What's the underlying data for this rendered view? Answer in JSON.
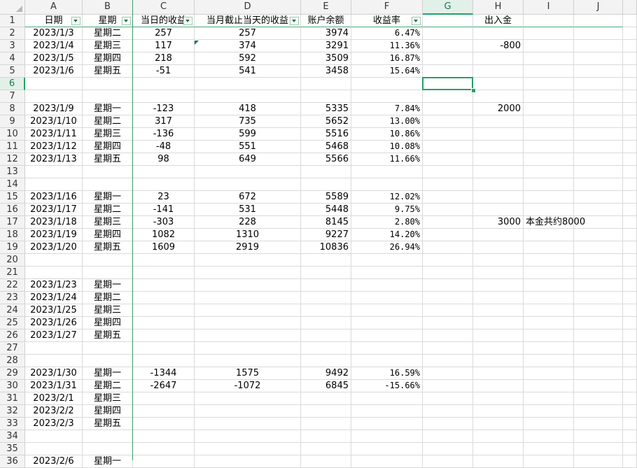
{
  "columns": [
    "A",
    "B",
    "C",
    "D",
    "E",
    "F",
    "G",
    "H",
    "I",
    "J"
  ],
  "selected_cell": "G6",
  "header": {
    "A": "日期",
    "B": "星期",
    "C": "当日的收益",
    "D": "当月截止当天的收益",
    "E": "账户余额",
    "F": "收益率",
    "G": "",
    "H": "出入金",
    "I": "",
    "J": ""
  },
  "rows": [
    {
      "n": "2",
      "A": "2023/1/3",
      "B": "星期二",
      "C": "257",
      "D": "257",
      "E": "3974",
      "F": "6.47%",
      "H": "",
      "I": ""
    },
    {
      "n": "3",
      "A": "2023/1/4",
      "B": "星期三",
      "C": "117",
      "D": "374",
      "E": "3291",
      "F": "11.36%",
      "H": "-800",
      "I": ""
    },
    {
      "n": "4",
      "A": "2023/1/5",
      "B": "星期四",
      "C": "218",
      "D": "592",
      "E": "3509",
      "F": "16.87%",
      "H": "",
      "I": ""
    },
    {
      "n": "5",
      "A": "2023/1/6",
      "B": "星期五",
      "C": "-51",
      "D": "541",
      "E": "3458",
      "F": "15.64%",
      "H": "",
      "I": ""
    },
    {
      "n": "6",
      "A": "",
      "B": "",
      "C": "",
      "D": "",
      "E": "",
      "F": "",
      "H": "",
      "I": ""
    },
    {
      "n": "7",
      "A": "",
      "B": "",
      "C": "",
      "D": "",
      "E": "",
      "F": "",
      "H": "",
      "I": ""
    },
    {
      "n": "8",
      "A": "2023/1/9",
      "B": "星期一",
      "C": "-123",
      "D": "418",
      "E": "5335",
      "F": "7.84%",
      "H": "2000",
      "I": ""
    },
    {
      "n": "9",
      "A": "2023/1/10",
      "B": "星期二",
      "C": "317",
      "D": "735",
      "E": "5652",
      "F": "13.00%",
      "H": "",
      "I": ""
    },
    {
      "n": "10",
      "A": "2023/1/11",
      "B": "星期三",
      "C": "-136",
      "D": "599",
      "E": "5516",
      "F": "10.86%",
      "H": "",
      "I": ""
    },
    {
      "n": "11",
      "A": "2023/1/12",
      "B": "星期四",
      "C": "-48",
      "D": "551",
      "E": "5468",
      "F": "10.08%",
      "H": "",
      "I": ""
    },
    {
      "n": "12",
      "A": "2023/1/13",
      "B": "星期五",
      "C": "98",
      "D": "649",
      "E": "5566",
      "F": "11.66%",
      "H": "",
      "I": ""
    },
    {
      "n": "13",
      "A": "",
      "B": "",
      "C": "",
      "D": "",
      "E": "",
      "F": "",
      "H": "",
      "I": ""
    },
    {
      "n": "14",
      "A": "",
      "B": "",
      "C": "",
      "D": "",
      "E": "",
      "F": "",
      "H": "",
      "I": ""
    },
    {
      "n": "15",
      "A": "2023/1/16",
      "B": "星期一",
      "C": "23",
      "D": "672",
      "E": "5589",
      "F": "12.02%",
      "H": "",
      "I": ""
    },
    {
      "n": "16",
      "A": "2023/1/17",
      "B": "星期二",
      "C": "-141",
      "D": "531",
      "E": "5448",
      "F": "9.75%",
      "H": "",
      "I": ""
    },
    {
      "n": "17",
      "A": "2023/1/18",
      "B": "星期三",
      "C": "-303",
      "D": "228",
      "E": "8145",
      "F": "2.80%",
      "H": "3000",
      "I": "本金共约8000"
    },
    {
      "n": "18",
      "A": "2023/1/19",
      "B": "星期四",
      "C": "1082",
      "D": "1310",
      "E": "9227",
      "F": "14.20%",
      "H": "",
      "I": ""
    },
    {
      "n": "19",
      "A": "2023/1/20",
      "B": "星期五",
      "C": "1609",
      "D": "2919",
      "E": "10836",
      "F": "26.94%",
      "H": "",
      "I": ""
    },
    {
      "n": "20",
      "A": "",
      "B": "",
      "C": "",
      "D": "",
      "E": "",
      "F": "",
      "H": "",
      "I": ""
    },
    {
      "n": "21",
      "A": "",
      "B": "",
      "C": "",
      "D": "",
      "E": "",
      "F": "",
      "H": "",
      "I": ""
    },
    {
      "n": "22",
      "A": "2023/1/23",
      "B": "星期一",
      "C": "",
      "D": "",
      "E": "",
      "F": "",
      "H": "",
      "I": ""
    },
    {
      "n": "23",
      "A": "2023/1/24",
      "B": "星期二",
      "C": "",
      "D": "",
      "E": "",
      "F": "",
      "H": "",
      "I": ""
    },
    {
      "n": "24",
      "A": "2023/1/25",
      "B": "星期三",
      "C": "",
      "D": "",
      "E": "",
      "F": "",
      "H": "",
      "I": ""
    },
    {
      "n": "25",
      "A": "2023/1/26",
      "B": "星期四",
      "C": "",
      "D": "",
      "E": "",
      "F": "",
      "H": "",
      "I": ""
    },
    {
      "n": "26",
      "A": "2023/1/27",
      "B": "星期五",
      "C": "",
      "D": "",
      "E": "",
      "F": "",
      "H": "",
      "I": ""
    },
    {
      "n": "27",
      "A": "",
      "B": "",
      "C": "",
      "D": "",
      "E": "",
      "F": "",
      "H": "",
      "I": ""
    },
    {
      "n": "28",
      "A": "",
      "B": "",
      "C": "",
      "D": "",
      "E": "",
      "F": "",
      "H": "",
      "I": ""
    },
    {
      "n": "29",
      "A": "2023/1/30",
      "B": "星期一",
      "C": "-1344",
      "D": "1575",
      "E": "9492",
      "F": "16.59%",
      "H": "",
      "I": ""
    },
    {
      "n": "30",
      "A": "2023/1/31",
      "B": "星期二",
      "C": "-2647",
      "D": "-1072",
      "E": "6845",
      "F": "-15.66%",
      "H": "",
      "I": ""
    },
    {
      "n": "31",
      "A": "2023/2/1",
      "B": "星期三",
      "C": "",
      "D": "",
      "E": "",
      "F": "",
      "H": "",
      "I": ""
    },
    {
      "n": "32",
      "A": "2023/2/2",
      "B": "星期四",
      "C": "",
      "D": "",
      "E": "",
      "F": "",
      "H": "",
      "I": ""
    },
    {
      "n": "33",
      "A": "2023/2/3",
      "B": "星期五",
      "C": "",
      "D": "",
      "E": "",
      "F": "",
      "H": "",
      "I": ""
    },
    {
      "n": "34",
      "A": "",
      "B": "",
      "C": "",
      "D": "",
      "E": "",
      "F": "",
      "H": "",
      "I": ""
    },
    {
      "n": "35",
      "A": "",
      "B": "",
      "C": "",
      "D": "",
      "E": "",
      "F": "",
      "H": "",
      "I": ""
    },
    {
      "n": "36",
      "A": "2023/2/6",
      "B": "星期一",
      "C": "",
      "D": "",
      "E": "",
      "F": "",
      "H": "",
      "I": ""
    }
  ],
  "colors": {
    "accent": "#21a366",
    "header_bg": "#f3f3f3",
    "gridline": "#dadada",
    "selected_header_bg": "#e1f0e8"
  }
}
